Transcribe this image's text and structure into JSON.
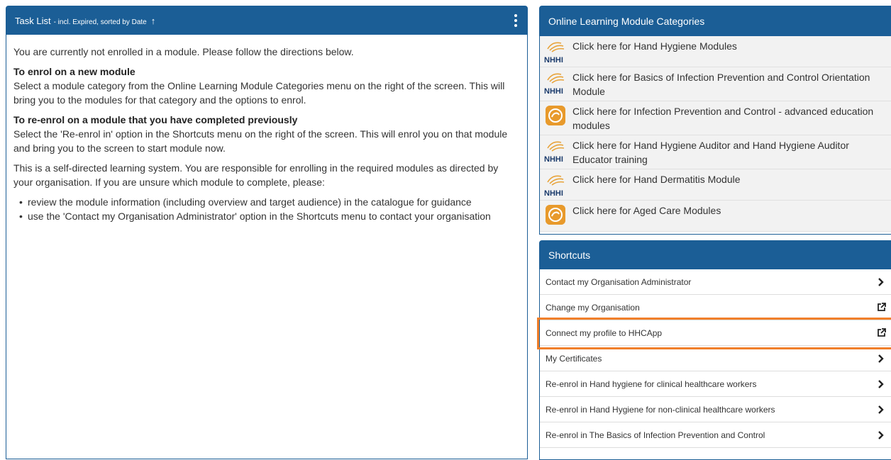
{
  "task_panel": {
    "title": "Task List",
    "subtitle": "- incl. Expired, sorted by Date",
    "sort_arrow": "↑",
    "intro": "You are currently not enrolled in a module. Please follow the directions below.",
    "sections": [
      {
        "heading": "To enrol on a new module",
        "text": "Select a module category from the Online Learning Module Categories menu on the right of the screen. This will bring you to the modules for that category and the options to enrol."
      },
      {
        "heading": "To re-enrol on a module that you have completed previously",
        "text": "Select the 'Re-enrol in' option in the Shortcuts menu on the right of the screen. This will enrol you on that module and bring you to the screen to start module now."
      }
    ],
    "self_directed": "This is a self-directed learning system. You are responsible for enrolling in the required modules as directed by your organisation. If you are unsure which module to complete, please:",
    "bullets": [
      "review the module information (including overview and target audience) in the catalogue for guidance",
      "use the 'Contact my Organisation Administrator' option in the Shortcuts menu to contact your organisation"
    ]
  },
  "categories_panel": {
    "title": "Online Learning Module Categories",
    "items": [
      {
        "label": "Click here for Hand Hygiene Modules",
        "icon": "nhhi-logo",
        "icon_text": "NHHI"
      },
      {
        "label": "Click here for Basics of Infection Prevention and Control Orientation Module",
        "icon": "nhhi-logo",
        "icon_text": "NHHI"
      },
      {
        "label": "Click here for Infection Prevention and Control - advanced education modules",
        "icon": "orange-badge"
      },
      {
        "label": "Click here for Hand Hygiene Auditor and Hand Hygiene Auditor Educator training",
        "icon": "nhhi-logo",
        "icon_text": "NHHI"
      },
      {
        "label": "Click here for Hand Dermatitis Module",
        "icon": "nhhi-logo",
        "icon_text": "NHHI"
      },
      {
        "label": "Click here for Aged Care Modules",
        "icon": "orange-badge"
      }
    ]
  },
  "shortcuts_panel": {
    "title": "Shortcuts",
    "items": [
      {
        "label": "Contact my Organisation Administrator",
        "icon": "chevron-right-icon"
      },
      {
        "label": "Change my Organisation",
        "icon": "external-link-icon"
      },
      {
        "label": "Connect my profile to HHCApp",
        "icon": "external-link-icon",
        "highlighted": true
      },
      {
        "label": "My Certificates",
        "icon": "chevron-right-icon"
      },
      {
        "label": "Re-enrol in Hand hygiene for clinical healthcare workers",
        "icon": "chevron-right-icon"
      },
      {
        "label": "Re-enrol in Hand Hygiene for non-clinical healthcare workers",
        "icon": "chevron-right-icon"
      },
      {
        "label": "Re-enrol in The Basics of Infection Prevention and Control",
        "icon": "chevron-right-icon"
      }
    ]
  },
  "colors": {
    "header_blue": "#1b5e96",
    "highlight_orange": "#f07f2a",
    "category_bg": "#f2f2f2"
  }
}
